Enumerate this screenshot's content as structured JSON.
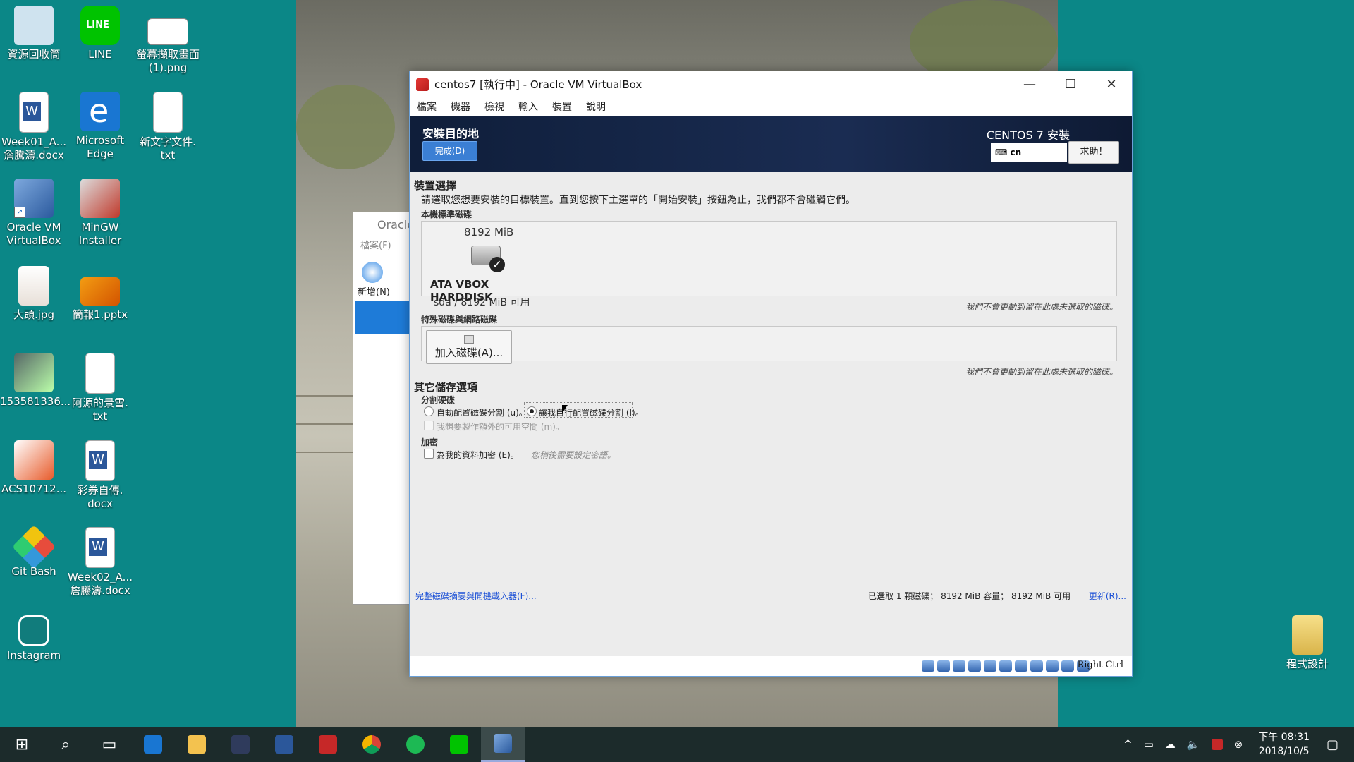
{
  "desktop": {
    "icons_left": [
      {
        "label": "資源回收筒",
        "icon": "recycle-bin-icon"
      },
      {
        "label": "Week01_A...\n詹騰濤.docx",
        "icon": "word-doc-icon"
      },
      {
        "label": "Oracle VM\nVirtualBox",
        "icon": "virtualbox-icon"
      },
      {
        "label": "大頭.jpg",
        "icon": "photo-icon"
      },
      {
        "label": "153581336...",
        "icon": "photo-icon"
      },
      {
        "label": "ACS10712...",
        "icon": "pptx-icon"
      },
      {
        "label": "Git Bash",
        "icon": "git-bash-icon"
      },
      {
        "label": "Instagram",
        "icon": "instagram-icon"
      }
    ],
    "icons_mid": [
      {
        "label": "LINE",
        "icon": "line-icon"
      },
      {
        "label": "Microsoft\nEdge",
        "icon": "edge-icon"
      },
      {
        "label": "MinGW\nInstaller",
        "icon": "mingw-icon"
      },
      {
        "label": "簡報1.pptx",
        "icon": "pptx-icon"
      },
      {
        "label": "阿源的景雪.\ntxt",
        "icon": "text-file-icon"
      },
      {
        "label": "彩券自傳.\ndocx",
        "icon": "word-doc-icon"
      },
      {
        "label": "Week02_A...\n詹騰濤.docx",
        "icon": "word-doc-icon"
      }
    ],
    "icons_right": [
      {
        "label": "螢幕擷取畫面\n(1).png",
        "icon": "screenshot-icon"
      },
      {
        "label": "新文字文件.\ntxt",
        "icon": "text-file-icon"
      }
    ],
    "folder_label": "程式設計"
  },
  "manager": {
    "title": "Oracle",
    "menu": "檔案(F)",
    "new_label": "新增(N)"
  },
  "window": {
    "title": "centos7 [執行中] - Oracle VM VirtualBox",
    "menu": [
      "檔案",
      "機器",
      "檢視",
      "輸入",
      "裝置",
      "說明"
    ]
  },
  "installer": {
    "page_title": "安裝目的地",
    "done_button": "完成(D)",
    "product": "CENTOS 7 安裝",
    "keyboard": "cn",
    "help_button": "求助！",
    "device_selection": "裝置選擇",
    "device_intro": "請選取您想要安裝的目標裝置。直到您按下主選單的「開始安裝」按鈕為止，我們都不會碰觸它們。",
    "local_disks": "本機標準磁碟",
    "disk": {
      "size": "8192 MiB",
      "name": "ATA VBOX HARDDISK",
      "info": "sda  /  8192 MiB 可用"
    },
    "note_local": "我們不會更動到留在此處未選取的磁碟。",
    "special_disks": "特殊磁碟與網路磁碟",
    "add_disk_button": "加入磁碟(A)...",
    "note_special": "我們不會更動到留在此處未選取的磁碟。",
    "other_options": "其它儲存選項",
    "partitioning": "分割硬碟",
    "auto_partition": "自動配置磁碟分割 (u)。",
    "manual_partition": "讓我自行配置磁碟分割 (I)。",
    "extra_space": "我想要製作額外的可用空間 (m)。",
    "encryption": "加密",
    "encrypt_label": "為我的資料加密 (E)。",
    "encrypt_hint": "您稍後需要設定密語。",
    "summary_link": "完整磁碟摘要與開機載入器(F)...",
    "summary_status": "已選取 1 顆磁碟；  8192 MiB 容量；  8192 MiB 可用",
    "refresh_link": "更新(R)..."
  },
  "statusbar": {
    "host_key": "Right Ctrl"
  },
  "taskbar": {
    "time": "下午 08:31",
    "date": "2018/10/5"
  }
}
